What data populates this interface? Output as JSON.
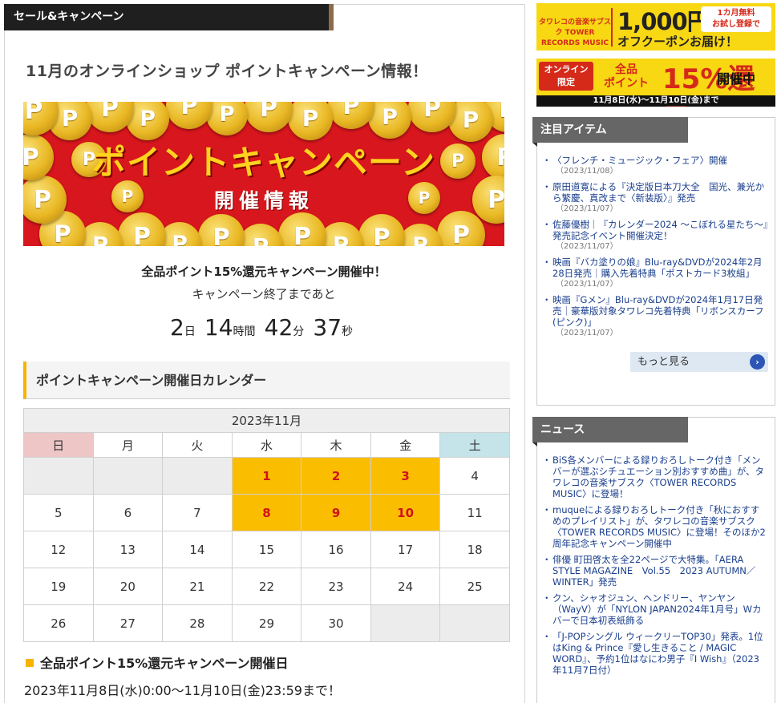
{
  "section": {
    "tab_label": "セール&キャンペーン"
  },
  "page": {
    "title": "11月のオンラインショップ ポイントキャンペーン情報！"
  },
  "banner": {
    "main_text": "ポイントキャンペーン",
    "sub_text": "開催情報",
    "coin_letter": "P"
  },
  "campaign": {
    "headline": "全品ポイント15%還元キャンペーン開催中！",
    "countdown_label": "キャンペーン終了まであと",
    "countdown": {
      "days": "2",
      "days_unit": "日",
      "hours": "14",
      "hours_unit": "時間",
      "minutes": "42",
      "minutes_unit": "分",
      "seconds": "37",
      "seconds_unit": "秒"
    }
  },
  "calendar": {
    "heading": "ポイントキャンペーン開催日カレンダー",
    "month_title": "2023年11月",
    "weekdays": [
      "日",
      "月",
      "火",
      "水",
      "木",
      "金",
      "土"
    ],
    "weeks": [
      [
        "",
        "",
        "",
        "1",
        "2",
        "3",
        "4"
      ],
      [
        "5",
        "6",
        "7",
        "8",
        "9",
        "10",
        "11"
      ],
      [
        "12",
        "13",
        "14",
        "15",
        "16",
        "17",
        "18"
      ],
      [
        "19",
        "20",
        "21",
        "22",
        "23",
        "24",
        "25"
      ],
      [
        "26",
        "27",
        "28",
        "29",
        "30",
        "",
        ""
      ]
    ],
    "highlighted_days": [
      "1",
      "2",
      "3",
      "8",
      "9",
      "10"
    ],
    "colors": {
      "highlight": "#fbbd00",
      "highlight_text": "#d0121b",
      "sunday": "#efc6c6",
      "saturday": "#c4e4ea"
    }
  },
  "period": {
    "title": "全品ポイント15%還元キャンペーン開催日",
    "text": "2023年11月8日(水)0:00～11月10日(金)23:59まで！"
  },
  "ads": {
    "subscription": {
      "brand": "タワレコの音楽サブスク TOWER RECORDS MUSIC",
      "price": "1,000円",
      "badge_line1": "1カ月無料",
      "badge_line2": "お試し登録で",
      "bottom": "オフクーポンお届け！"
    },
    "points": {
      "limited_line1": "オンライン",
      "limited_line2": "限定",
      "points_line1": "全品",
      "points_line2": "ポイント",
      "percent": "15%還元",
      "status": "開催中",
      "dates": "11月8日(水)～11月10日(金)まで"
    }
  },
  "featured": {
    "title": "注目アイテム",
    "items": [
      {
        "text": "〈フレンチ・ミュージック・フェア〉開催",
        "date": "（2023/11/08）"
      },
      {
        "text": "原田道寛による『決定版日本刀大全　国光、兼光から繁慶、真改まで〈新装版〉』発売",
        "date": "（2023/11/07）"
      },
      {
        "text": "佐藤優樹｜『カレンダー2024 ～こぼれる星たち～』発売記念イベント開催決定！",
        "date": "（2023/11/07）"
      },
      {
        "text": "映画『バカ塗りの娘』Blu-ray&DVDが2024年2月28日発売｜購入先着特典「ポストカード3枚組」",
        "date": "（2023/11/07）"
      },
      {
        "text": "映画『Gメン』Blu-ray&DVDが2024年1月17日発売｜豪華版対象タワレコ先着特典「リボンスカーフ(ピンク)」",
        "date": "（2023/11/07）"
      }
    ],
    "more_label": "もっと見る"
  },
  "news": {
    "title": "ニュース",
    "items": [
      {
        "text": "BiS各メンバーによる録りおろしトーク付き「メンバーが選ぶシチュエーション別おすすめ曲」が、タワレコの音楽サブスク〈TOWER RECORDS MUSIC〉に登場！"
      },
      {
        "text": "muqueによる録りおろしトーク付き「秋におすすめのプレイリスト」が、タワレコの音楽サブスク〈TOWER RECORDS MUSIC〉に登場！そのほか2周年記念キャンペーン開催中"
      },
      {
        "text": "俳優 町田啓太を全22ページで大特集。「AERA STYLE MAGAZINE　Vol.55　2023 AUTUMN／WINTER」発売"
      },
      {
        "text": "クン、シャオジュン、ヘンドリー、ヤンヤン（WayV）が「NYLON JAPAN2024年1月号」Wカバーで日本初表紙飾る"
      },
      {
        "text": "「J-POPシングル ウィークリーTOP30」発表。1位はKing & Prince『愛し生きること / MAGIC WORD』、予約1位はなにわ男子『I Wish』（2023年11月7日付）"
      }
    ]
  }
}
